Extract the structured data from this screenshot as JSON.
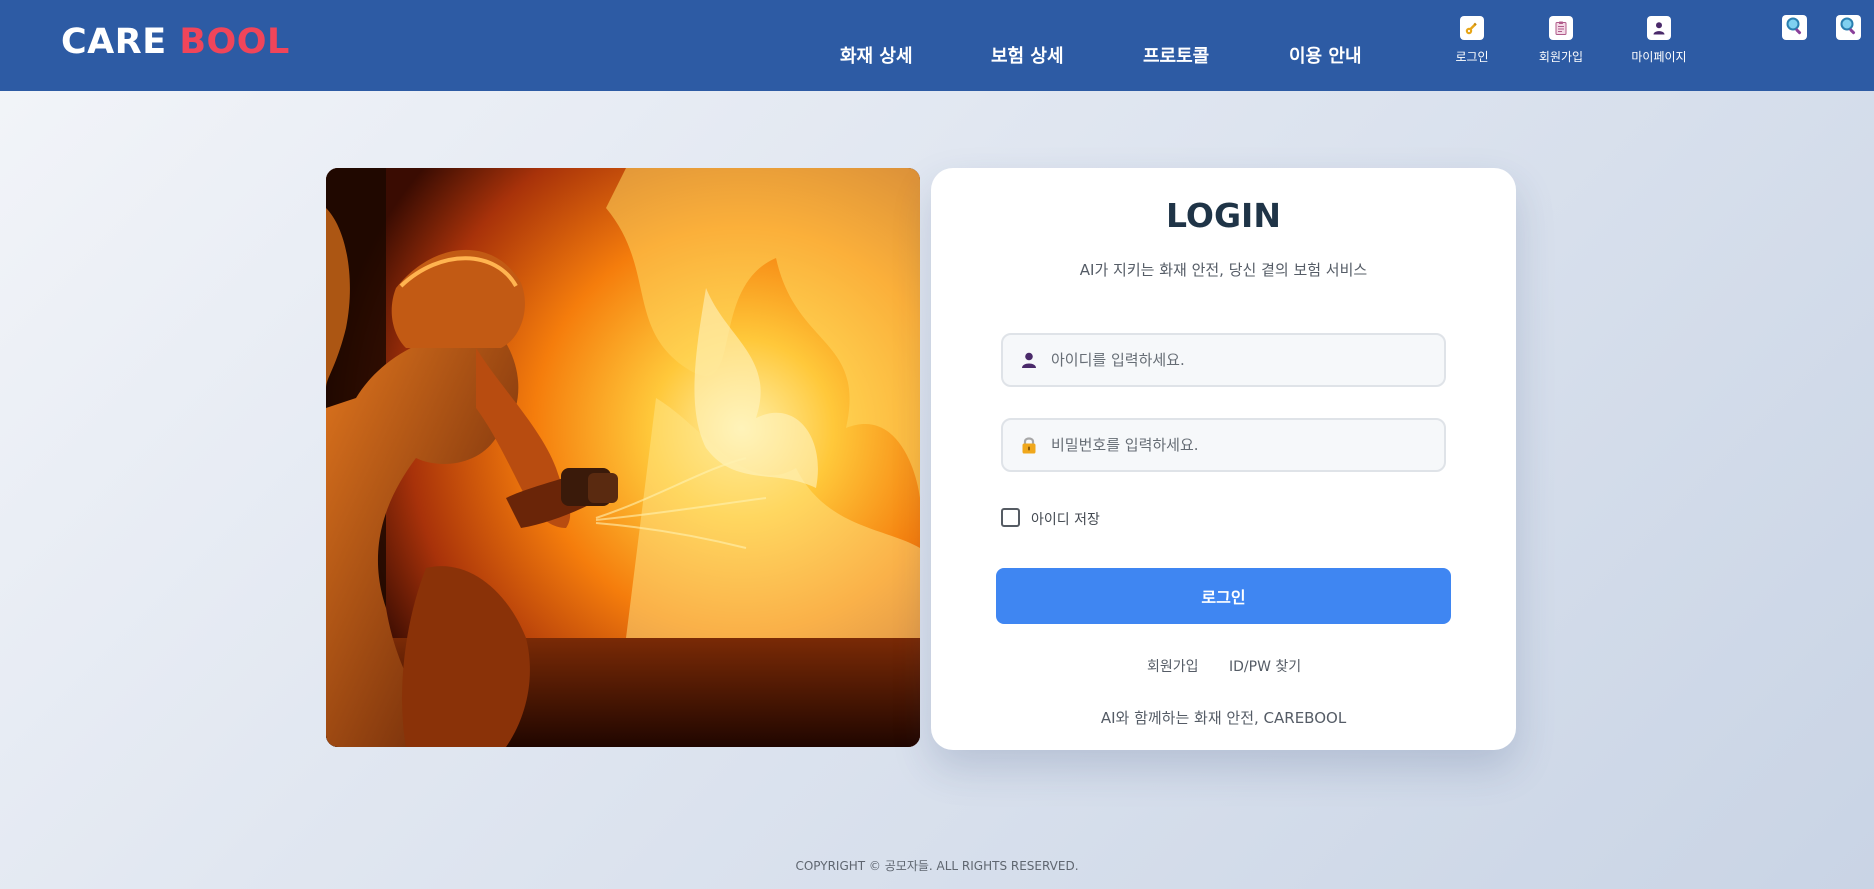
{
  "header": {
    "logo_part1": "CARE",
    "logo_part2": "BOOL",
    "nav": [
      "화재 상세",
      "보험 상세",
      "프로토콜",
      "이용 안내"
    ],
    "utility": {
      "login": "로그인",
      "signup": "회원가입",
      "mypage": "마이페이지"
    },
    "icons": {
      "login": "key-icon",
      "signup": "clipboard-icon",
      "mypage": "user-icon",
      "search": "magnifier-icon"
    }
  },
  "hero_image": {
    "subject": "firefighter-spraying-hose-at-flames"
  },
  "login_card": {
    "title": "LOGIN",
    "subtitle": "AI가 지키는 화재 안전, 당신 곁의 보험 서비스",
    "id_placeholder": "아이디를 입력하세요.",
    "id_value": "",
    "pw_placeholder": "비밀번호를 입력하세요.",
    "pw_value": "",
    "remember_label": "아이디 저장",
    "remember_checked": false,
    "login_button": "로그인",
    "signup_link": "회원가입",
    "find_link": "ID/PW 찾기",
    "tagline": "AI와 함께하는 화재 안전, CAREBOOL"
  },
  "footer": {
    "copyright": "COPYRIGHT © 공모자들. ALL RIGHTS RESERVED."
  },
  "colors": {
    "header_bg": "#2d5ba4",
    "logo_accent": "#f0455a",
    "primary_button": "#3f86f2",
    "title_text": "#1f3447"
  }
}
